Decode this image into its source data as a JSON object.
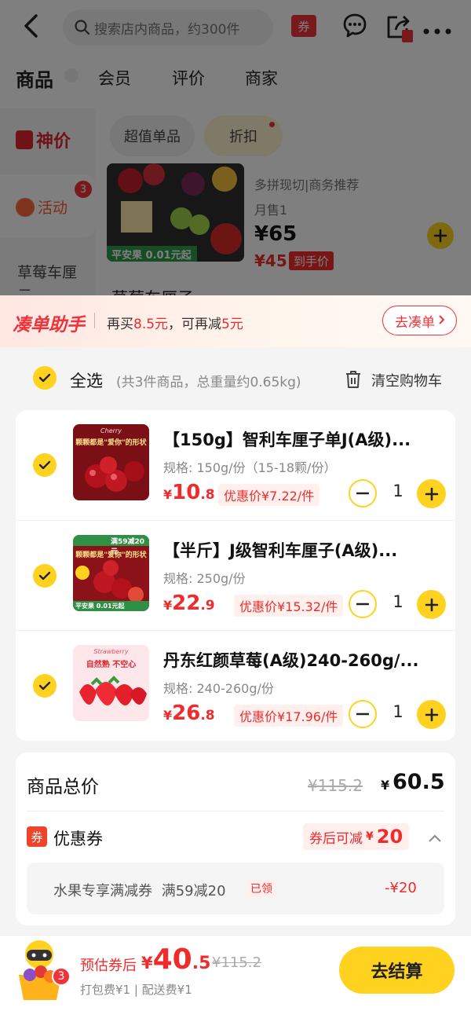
{
  "topbar": {
    "search_placeholder": "搜索店内商品，约300件",
    "coupon_badge": "券"
  },
  "tabs": [
    {
      "label": "商品"
    },
    {
      "label": "会员"
    },
    {
      "label": "评价"
    },
    {
      "label": "商家"
    }
  ],
  "store": {
    "logo_text": "神价",
    "sidebar_activity": "活动",
    "sidebar_activity_badge": "3",
    "sidebar_category": "草莓车厘子",
    "filter_pills": [
      "超值单品",
      "折扣"
    ],
    "product_subtitle": "多拼现切|商务推荐",
    "product_sales": "月售1",
    "product_price": "¥65",
    "product_final_price": "¥45",
    "product_final_label": "到手价",
    "product_badge": "平安果 0.01元起",
    "section_heading": "草莓车厘子"
  },
  "assistant": {
    "title": "凑单助手",
    "text_prefix": "再买",
    "amount": "8.5元",
    "text_mid": "，可再减",
    "save": "5元",
    "button": "去凑单"
  },
  "select_all": {
    "label": "全选",
    "summary": "(共3件商品，总重量约0.65kg)",
    "clear": "清空购物车"
  },
  "items": [
    {
      "name": "【150g】智利车厘子单J(A级)...",
      "spec": "规格: 150g/份（15-18颗/份）",
      "price_int": "10",
      "price_dec": ".8",
      "discount": "优惠价¥7.22/件",
      "qty": "1",
      "thumb_top": "Cherry",
      "thumb_text": "颗颗都是\"爱你\"的形状"
    },
    {
      "name": "【半斤】J级智利车厘子(A级)...",
      "spec": "规格: 250g/份",
      "price_int": "22",
      "price_dec": ".9",
      "discount": "优惠价¥15.32/件",
      "qty": "1",
      "thumb_top": "满59减20元",
      "thumb_text": "颗颗都是\"爱你\"的形状",
      "thumb_tag": "平安果 0.01元起"
    },
    {
      "name": "丹东红颜草莓(A级)240-260g/...",
      "spec": "规格: 240-260g/份",
      "price_int": "26",
      "price_dec": ".8",
      "discount": "优惠价¥17.96/件",
      "qty": "1",
      "thumb_top": "Strawberry",
      "thumb_text": "自然熟 不空心"
    }
  ],
  "summary": {
    "total_label": "商品总价",
    "original": "¥115.2",
    "currency": "¥",
    "total": "60.5",
    "coupon_label": "优惠券",
    "coupon_icon": "券",
    "coupon_reduce_label": "券后可减",
    "coupon_reduce_amount": "20",
    "coupon_name": "水果专享满减券",
    "coupon_rule": "满59减20",
    "coupon_status": "已领",
    "coupon_value": "-¥20"
  },
  "bottom": {
    "estimate_label": "预估券后",
    "currency": "¥",
    "price_int": "40",
    "price_dec": ".5",
    "original": "¥115.2",
    "fees": "打包费¥1 | 配送费¥1",
    "cart_badge": "3",
    "checkout": "去结算"
  },
  "colors": {
    "accent": "#ffd21f",
    "price_red": "#f02b2b"
  }
}
